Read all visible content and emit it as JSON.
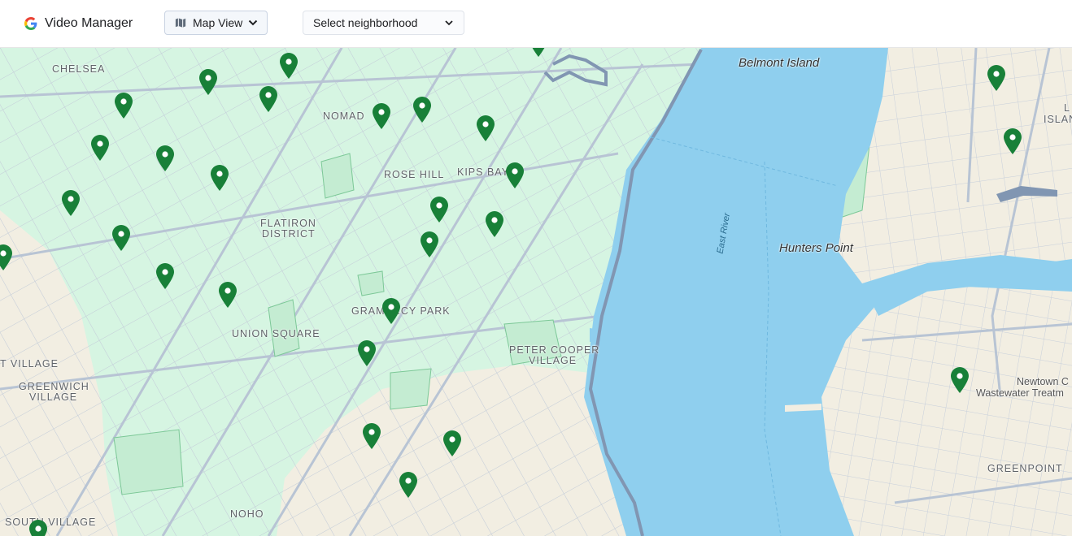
{
  "header": {
    "brand_title": "Video Manager",
    "view_button_label": "Map View",
    "neighborhood_placeholder": "Select neighborhood"
  },
  "icons": {
    "brand": "google-g-icon",
    "view": "map-icon",
    "view_dropdown": "chevron-down-icon",
    "neighborhood_dropdown": "chevron-down-icon",
    "marker": "map-pin-icon"
  },
  "colors": {
    "pin": "#188038",
    "land": "#f2eee2",
    "highlight_zone": "#d6f5e2",
    "water": "#8fcfee",
    "road": "#b8c4d4",
    "highway": "#8196b2"
  },
  "map": {
    "labels": {
      "chelsea": "CHELSEA",
      "nomad": "NOMAD",
      "rose_hill": "ROSE HILL",
      "kips_bay": "KIPS BAY",
      "flatiron_1": "FLATIRON",
      "flatiron_2": "DISTRICT",
      "gramercy": "GRAMERCY PARK",
      "union_square": "UNION SQUARE",
      "east_village": "T VILLAGE",
      "greenwich_1": "GREENWICH",
      "greenwich_2": "VILLAGE",
      "peter_cooper_1": "PETER COOPER",
      "peter_cooper_2": "VILLAGE",
      "noho": "NOHO",
      "south_village": "SOUTH VILLAGE",
      "greenpoint": "GREENPOINT",
      "belmont": "Belmont Island",
      "hunters_point": "Hunters Point",
      "east_river": "East River",
      "newtown_1": "Newtown C",
      "newtown_2": "Wastewater Treatm",
      "island_1": "L",
      "island_2": "ISLAN"
    }
  }
}
